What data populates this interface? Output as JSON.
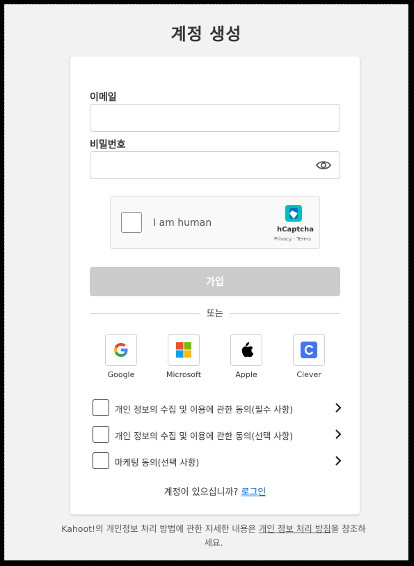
{
  "page": {
    "title": "계정 생성"
  },
  "form": {
    "email_label": "이메일",
    "email_value": "",
    "password_label": "비밀번호",
    "password_value": "",
    "submit_label": "가입"
  },
  "captcha": {
    "checkbox_label": "I am human",
    "brand": "hCaptcha",
    "links": "Privacy - Terms"
  },
  "divider": {
    "label": "또는"
  },
  "social": [
    {
      "label": "Google",
      "icon": "google-icon"
    },
    {
      "label": "Microsoft",
      "icon": "microsoft-icon"
    },
    {
      "label": "Apple",
      "icon": "apple-icon"
    },
    {
      "label": "Clever",
      "icon": "clever-icon"
    }
  ],
  "consents": [
    {
      "label": "개인 정보의 수집 및 이용에 관한 동의(필수 사항)",
      "checked": false
    },
    {
      "label": "개인 정보의 수집 및 이용에 관한 동의(선택 사항)",
      "checked": false
    },
    {
      "label": "마케팅 동의(선택 사항)",
      "checked": false
    }
  ],
  "login": {
    "prompt": "계정이 있으십니까?",
    "link": "로그인"
  },
  "footer": {
    "text_before": "Kahoot!의 개인정보 처리 방법에 관한 자세한 내용은 ",
    "link": "개인 정보 처리 방침",
    "text_after": "을 참조하세요."
  },
  "colors": {
    "submit_disabled": "#cccccc",
    "link": "#0066cc",
    "clever": "#4274f6"
  }
}
